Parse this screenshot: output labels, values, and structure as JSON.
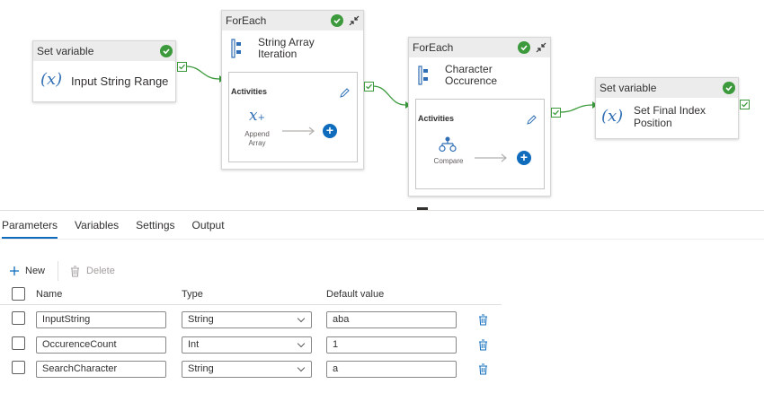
{
  "pipeline": {
    "set_var_1": {
      "type": "Set variable",
      "name": "Input String Range",
      "icon": "fx-variable-icon"
    },
    "foreach_1": {
      "type": "ForEach",
      "name_line1": "String Array",
      "name_line2": "Iteration",
      "activities_label": "Activities",
      "inner_line1": "Append",
      "inner_line2": "Array"
    },
    "foreach_2": {
      "type": "ForEach",
      "name_line1": "Character",
      "name_line2": "Occurence",
      "activities_label": "Activities",
      "inner": "Compare"
    },
    "set_var_2": {
      "type": "Set variable",
      "name_line1": "Set Final Index",
      "name_line2": "Position"
    }
  },
  "tabs": [
    "Parameters",
    "Variables",
    "Settings",
    "Output"
  ],
  "active_tab": "Parameters",
  "toolbar": {
    "new_label": "New",
    "delete_label": "Delete"
  },
  "grid": {
    "headers": {
      "name": "Name",
      "type": "Type",
      "default": "Default value"
    },
    "rows": [
      {
        "name": "InputString",
        "type": "String",
        "default": "aba"
      },
      {
        "name": "OccurenceCount",
        "type": "Int",
        "default": "1"
      },
      {
        "name": "SearchCharacter",
        "type": "String",
        "default": "a"
      }
    ]
  },
  "colors": {
    "accent": "#0f6cbd",
    "success": "#3c9a3c",
    "fx": "#2f6eb5",
    "wire": "#3c9a3c"
  }
}
